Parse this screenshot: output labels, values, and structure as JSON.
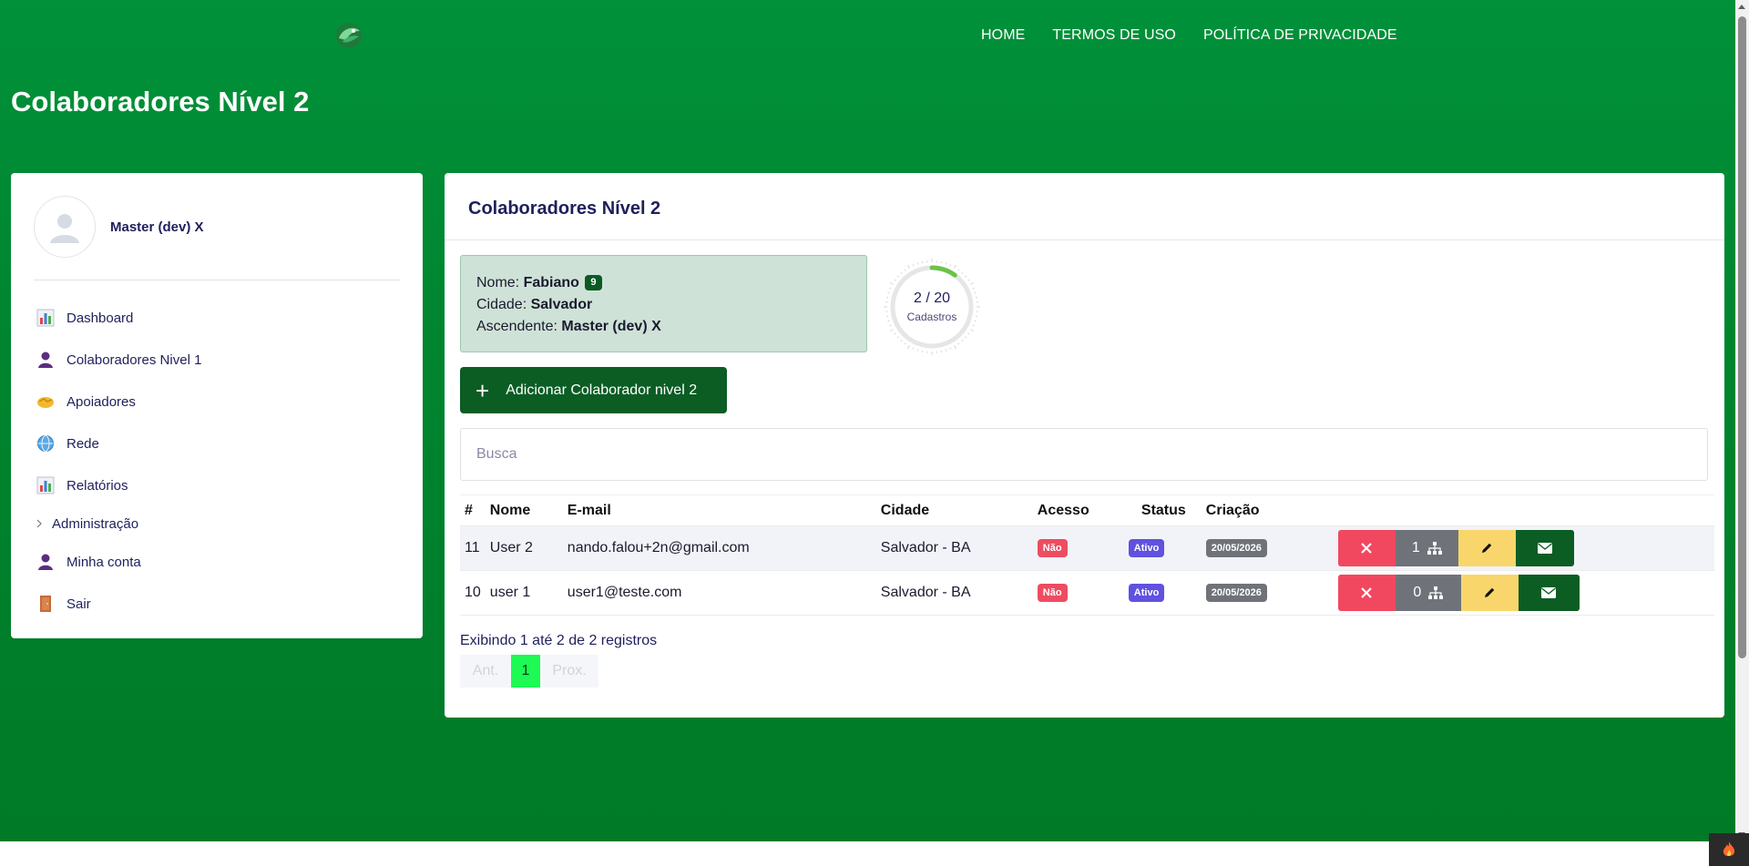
{
  "header": {
    "nav": [
      "HOME",
      "TERMOS DE USO",
      "POLÍTICA DE PRIVACIDADE"
    ],
    "page_title": "Colaboradores Nível 2"
  },
  "sidebar": {
    "user_name": "Master (dev) X",
    "items": [
      {
        "label": "Dashboard",
        "icon": "bar-chart-icon"
      },
      {
        "label": "Colaboradores Nivel 1",
        "icon": "user-icon"
      },
      {
        "label": "Apoiadores",
        "icon": "handshake-icon"
      },
      {
        "label": "Rede",
        "icon": "globe-icon"
      },
      {
        "label": "Relatórios",
        "icon": "bar-chart-icon"
      },
      {
        "label": "Administração",
        "icon": "chevron-right-icon"
      },
      {
        "label": "Minha conta",
        "icon": "user-icon"
      },
      {
        "label": "Sair",
        "icon": "door-icon"
      }
    ]
  },
  "main": {
    "title": "Colaboradores Nível 2",
    "info": {
      "name_label": "Nome:",
      "name_value": "Fabiano",
      "name_badge": "9",
      "city_label": "Cidade:",
      "city_value": "Salvador",
      "ascendant_label": "Ascendente:",
      "ascendant_value": "Master (dev) X"
    },
    "gauge": {
      "value_text": "2 / 20",
      "label": "Cadastros",
      "current": 2,
      "max": 20
    },
    "add_button": "Adicionar Colaborador nivel 2",
    "search_placeholder": "Busca",
    "table": {
      "headers": [
        "#",
        "Nome",
        "E-mail",
        "Cidade",
        "Acesso",
        "Status",
        "Criação"
      ],
      "rows": [
        {
          "id": "11",
          "name": "User 2",
          "email": "nando.falou+2n@gmail.com",
          "city": "Salvador - BA",
          "access": "Não",
          "status": "Ativo",
          "created": "20/05/2026",
          "count": "1"
        },
        {
          "id": "10",
          "name": "user 1",
          "email": "user1@teste.com",
          "city": "Salvador - BA",
          "access": "Não",
          "status": "Ativo",
          "created": "20/05/2026",
          "count": "0"
        }
      ]
    },
    "footer_info": "Exibindo 1 até 2 de 2 registros",
    "pager": {
      "prev": "Ant.",
      "current": "1",
      "next": "Prox."
    }
  },
  "colors": {
    "background": "#00913a",
    "primary_dark": "#0b5d24",
    "danger": "#f1485f",
    "warning": "#f8d66c",
    "status": "#6151e0",
    "pager_active": "#1dfa54"
  }
}
